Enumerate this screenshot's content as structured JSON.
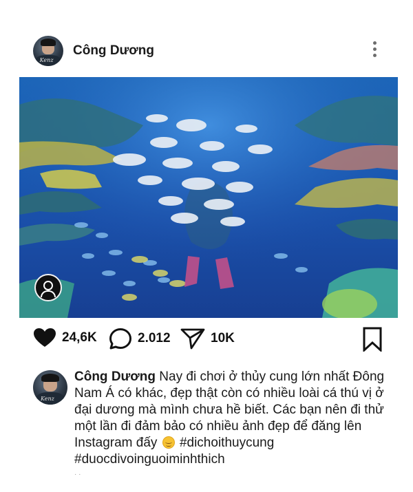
{
  "post": {
    "username": "Công Dương",
    "avatar_watermark": "Kenz",
    "photo_icon": "underwater-aquarium-photo",
    "likes": "24,6K",
    "comments": "2.012",
    "shares": "10K",
    "caption": {
      "username": "Công Dương",
      "text_part1": " Nay đi chơi ở thủy cung lớn nhất Đông Nam Á có khác, đẹp thật còn có nhiều loài cá thú vị ở đại dương mà mình chưa hề biết. Các bạn nên đi thử một lần đi đảm bảo có nhiều ảnh đẹp để đăng lên Instagram đấy ",
      "emoji": "smiling-face",
      "hashtag1": " #dichoithuycung",
      "hashtag2": "#duocdivoinguoiminhthich",
      "trailing": "· ·"
    }
  },
  "colors": {
    "text": "#111111",
    "icon": "#1a1a1a",
    "muted": "#6d6d6d",
    "water_top": "#1c66b8",
    "water_bottom": "#173f92"
  }
}
